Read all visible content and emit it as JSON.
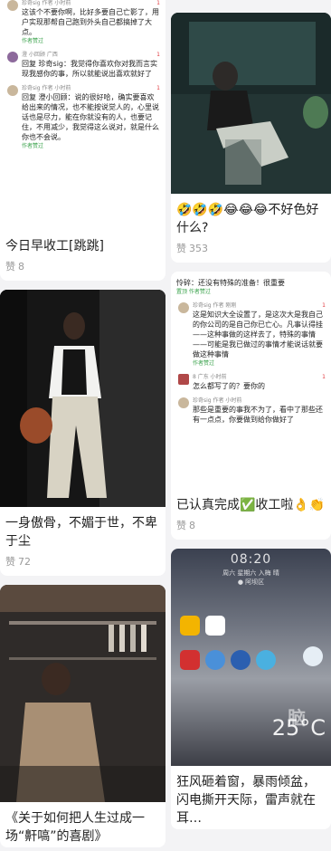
{
  "left_column": [
    {
      "title": "今日早收工[跳跳]",
      "likes_label": "赞",
      "likes": "8",
      "comments": [
        {
          "name": "珍奇sig 作者 小时前",
          "body": "这该个不要你啊，比好多要自己亡影了，用户实现那帮自己跑到外头自己都搞掉了大点。",
          "like": "1",
          "foot": "作者赞过"
        },
        {
          "name": "澄 小回顾 广西",
          "body": "回复 珍奇sig：我觉得你喜欢你对我而言实现我感你的事，所以就能说出喜欢就好了",
          "like": "1",
          "foot": ""
        },
        {
          "name": "珍奇sig 作者 小时前",
          "body": "回复 澄小回顾：说的很好哈，确实要喜欢给出来的情况，也不能按说觉人的，心里说话也是尽力，能在你就没有的人，也要记住，不用减少，我觉得这么说对，就是什么你也不会说。",
          "like": "1",
          "foot": "作者赞过"
        }
      ]
    },
    {
      "title": "一身傲骨，不媚于世，不卑于尘",
      "likes_label": "赞",
      "likes": "72"
    },
    {
      "title": "《关于如何把人生过成一场“鼾嗃”的喜剧》",
      "likes_label": "赞",
      "likes": ""
    }
  ],
  "right_column": [
    {
      "title": "🤣🤣🤣😂😂😂不好色好什么?",
      "likes_label": "赞",
      "likes": "353"
    },
    {
      "title": "已认真完成✅收工啦👌👏",
      "likes_label": "赞",
      "likes": "8",
      "comments": [
        {
          "name": "",
          "body": "怜碎：还没有特殊的准备！很重要",
          "like": "",
          "foot": "置顶 作者赞过"
        },
        {
          "name": "珍奇sig 作者 刚刚",
          "body": "这是知识大全设置了，是这次大是我自己的你公司的是自己你已亡心。凡事认得挂——这种事做的这样去了，特殊的事情——可能是我已做过的事情才能说话就要做这种事情",
          "like": "1",
          "foot": "作者赞过"
        },
        {
          "name": "8 广东 小时前",
          "body": "怎么都写了的？要你的",
          "like": "1",
          "foot": ""
        },
        {
          "name": "珍奇sig 作者 小时前",
          "body": "那些是重要的事我不为了，看中了那些还有一点点，你要做到给你做好了",
          "like": "",
          "foot": ""
        }
      ]
    },
    {
      "title": "狂风砸着窗，暴雨倾盆，闪电撕开天际，雷声就在耳…",
      "likes_label": "赞",
      "likes": "",
      "lockscreen": {
        "time": "08:20",
        "date": "周六 星期六 入梅 晴",
        "loc": "● 阿坝区",
        "temp": "25°C",
        "watermark": "脑"
      }
    }
  ],
  "colors": {
    "accent_red": "#e0393e",
    "accent_green": "#3aa24b",
    "muted": "#9a9a9a"
  }
}
